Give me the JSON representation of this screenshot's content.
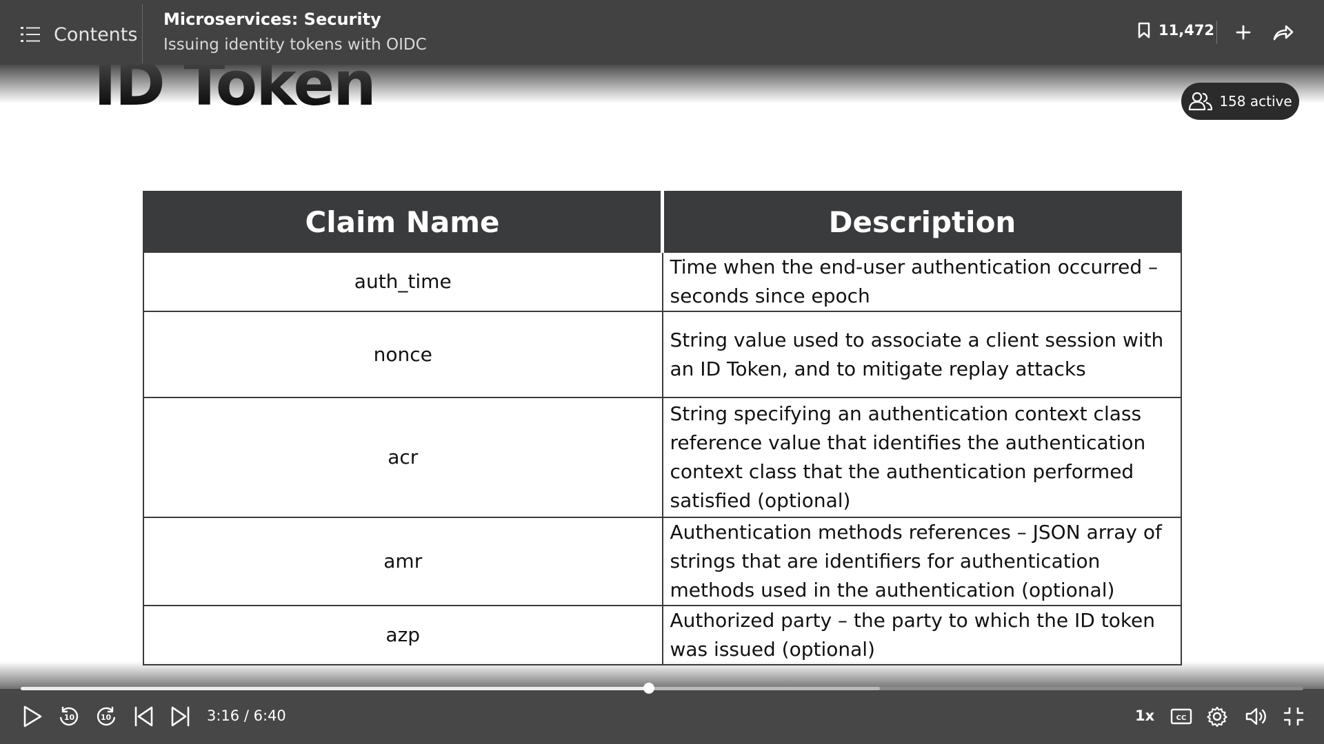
{
  "header": {
    "contents_label": "Contents",
    "course_title": "Microservices: Security",
    "video_title": "Issuing identity tokens with OIDC",
    "bookmark_count": "11,472",
    "icons": [
      "list-icon",
      "bookmark-icon",
      "plus-icon",
      "share-icon"
    ]
  },
  "viewers": {
    "label": "158 active",
    "icon": "users-icon"
  },
  "slide": {
    "title": "ID Token",
    "table": {
      "headers": [
        "Claim Name",
        "Description"
      ],
      "rows": [
        {
          "name": "auth_time",
          "description": "Time when the end-user authentication occurred – seconds since epoch"
        },
        {
          "name": "nonce",
          "description": "String value used to associate a client session with an ID Token, and to mitigate replay attacks"
        },
        {
          "name": "acr",
          "description": "String specifying an authentication context class reference value that identifies the authentication context class that the authentication performed satisfied (optional)"
        },
        {
          "name": "amr",
          "description": "Authentication methods references – JSON array of strings that are identifiers for authentication methods used in the authentication (optional)"
        },
        {
          "name": "azp",
          "description": "Authorized party – the party to which the ID token was issued (optional)"
        }
      ]
    }
  },
  "player": {
    "current_time": "3:16",
    "duration": "6:40",
    "time_display": "3:16 / 6:40",
    "played_fraction": 0.49,
    "buffered_fraction": 0.67,
    "speed_label": "1x",
    "colors": {
      "bar": "#474747",
      "track": "#8a8a8a",
      "played": "#eeeeee"
    },
    "icons": [
      "play-icon",
      "rewind-10-icon",
      "forward-10-icon",
      "previous-icon",
      "next-icon",
      "captions-icon",
      "settings-icon",
      "volume-icon",
      "exit-fullscreen-icon"
    ]
  }
}
